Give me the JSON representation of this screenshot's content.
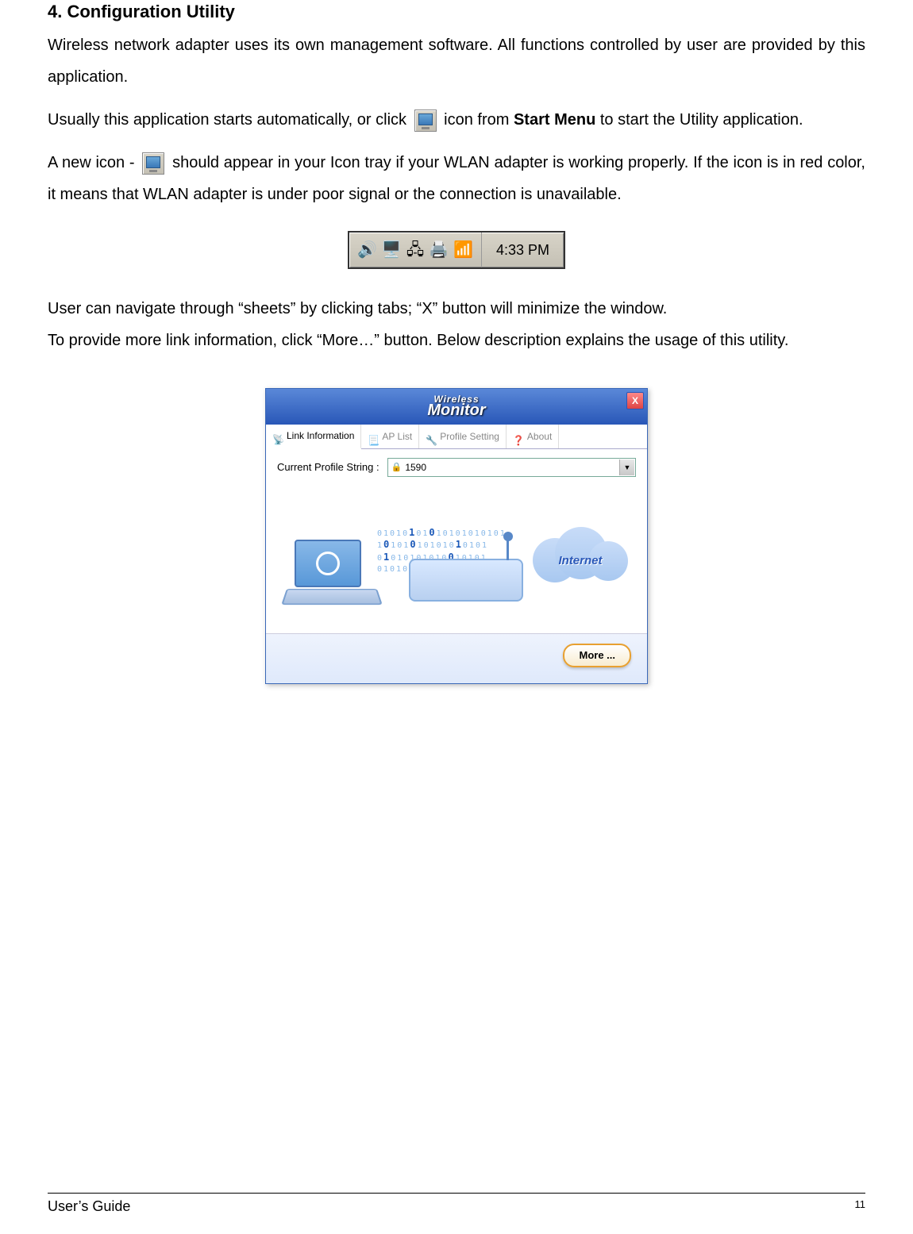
{
  "section_title": "4. Configuration Utility",
  "para1": "Wireless network adapter uses its own management software. All functions controlled by user are provided by this application.",
  "para2a": "Usually this application starts automatically, or click ",
  "para2b": " icon from ",
  "para2_strong": "Start Menu",
  "para2c": " to start the Utility application.",
  "para3a": "A new icon - ",
  "para3b": " should appear in your Icon tray if your WLAN adapter is working properly. If the icon is in red color, it means that WLAN adapter is under poor signal or the connection is unavailable.",
  "tray_time": "4:33 PM",
  "para4": "User can navigate through “sheets” by clicking tabs; “X” button will minimize the window.",
  "para5": "To provide more link information, click “More…” button. Below description explains the usage of this utility.",
  "app": {
    "brand_small": "Wireless",
    "brand_big": "Monitor",
    "close_x": "X",
    "tabs": {
      "link": "Link Information",
      "ap": "AP List",
      "profile": "Profile Setting",
      "about": "About"
    },
    "profile_label": "Current Profile String :",
    "profile_value": "1590",
    "cloud_label": "Internet",
    "more_label": "More ..."
  },
  "footer": {
    "left": "User’s Guide",
    "page": "11"
  }
}
